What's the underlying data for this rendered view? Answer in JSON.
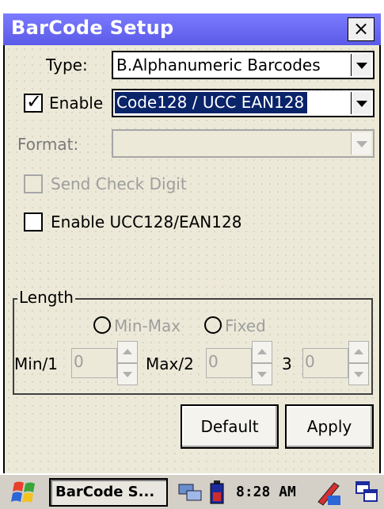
{
  "window": {
    "title": "BarCode Setup",
    "close_label": "×"
  },
  "type_row": {
    "label": "Type:",
    "value": "B.Alphanumeric Barcodes"
  },
  "enable_row": {
    "label": "Enable",
    "checked": true,
    "value": "Code128 / UCC EAN128"
  },
  "format_row": {
    "label": "Format:",
    "value": ""
  },
  "send_check_digit": {
    "label": "Send Check Digit",
    "checked": false,
    "enabled": false
  },
  "enable_ucc": {
    "label": "Enable UCC128/EAN128",
    "checked": false
  },
  "length": {
    "legend": "Length",
    "min_max_label": "Min-Max",
    "fixed_label": "Fixed",
    "min_label": "Min/1",
    "min_value": "0",
    "max_label": "Max/2",
    "max_value": "0",
    "third_label": "3",
    "third_value": "0"
  },
  "buttons": {
    "default": "Default",
    "apply": "Apply"
  },
  "taskbar": {
    "task_label": "BarCode S...",
    "clock": "8:28 AM"
  },
  "colors": {
    "titlebar": "#6b6bf5",
    "selection": "#0a246a",
    "window_bg": "#ece9d8"
  }
}
